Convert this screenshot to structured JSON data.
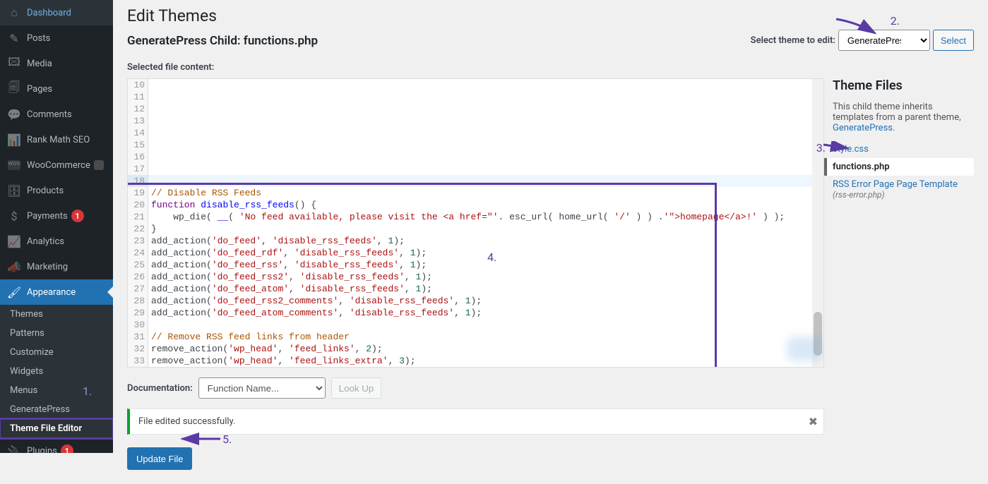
{
  "sidebar": {
    "items": [
      {
        "icon": "dashboard-icon",
        "glyph": "⌂",
        "label": "Dashboard"
      },
      {
        "icon": "posts-icon",
        "glyph": "✎",
        "label": "Posts"
      },
      {
        "icon": "media-icon",
        "glyph": "🖾",
        "label": "Media"
      },
      {
        "icon": "pages-icon",
        "glyph": "🗐",
        "label": "Pages"
      },
      {
        "icon": "comments-icon",
        "glyph": "💬",
        "label": "Comments"
      },
      {
        "icon": "rankmath-icon",
        "glyph": "📊",
        "label": "Rank Math SEO"
      },
      {
        "icon": "woocommerce-icon",
        "glyph": "woo",
        "label": "WooCommerce",
        "badge": ""
      },
      {
        "icon": "products-icon",
        "glyph": "🗄",
        "label": "Products"
      },
      {
        "icon": "payments-icon",
        "glyph": "$",
        "label": "Payments",
        "badge": "1"
      },
      {
        "icon": "analytics-icon",
        "glyph": "📈",
        "label": "Analytics"
      },
      {
        "icon": "marketing-icon",
        "glyph": "📣",
        "label": "Marketing"
      },
      {
        "icon": "appearance-icon",
        "glyph": "🖌",
        "label": "Appearance",
        "current": true
      },
      {
        "icon": "plugins-icon",
        "glyph": "🔌",
        "label": "Plugins",
        "badge": "1"
      }
    ],
    "submenu": [
      {
        "label": "Themes"
      },
      {
        "label": "Patterns"
      },
      {
        "label": "Customize"
      },
      {
        "label": "Widgets"
      },
      {
        "label": "Menus"
      },
      {
        "label": "GeneratePress",
        "anno": "1."
      },
      {
        "label": "Theme File Editor",
        "active": true
      }
    ]
  },
  "page": {
    "title": "Edit Themes",
    "subtitle": "GeneratePress Child: functions.php",
    "selected_file_label": "Selected file content:",
    "select_theme_label": "Select theme to edit:",
    "theme_option": "GeneratePress Child",
    "select_btn": "Select"
  },
  "code": {
    "lines": [
      {
        "n": 10,
        "html": ""
      },
      {
        "n": 11,
        "html": ""
      },
      {
        "n": 12,
        "html": ""
      },
      {
        "n": 13,
        "html": ""
      },
      {
        "n": 14,
        "html": ""
      },
      {
        "n": 15,
        "html": ""
      },
      {
        "n": 16,
        "html": ""
      },
      {
        "n": 17,
        "html": ""
      },
      {
        "n": 18,
        "html": "",
        "hl": true
      },
      {
        "n": 19,
        "html": "<span class='c-comment'>// Disable RSS Feeds</span>"
      },
      {
        "n": 20,
        "html": "<span class='c-keyword'>function</span> <span class='c-def'>disable_rss_feeds</span>() {"
      },
      {
        "n": 21,
        "html": "    wp_die( <span class='c-def'>__</span>( <span class='c-string'>'No feed available, please visit the &lt;a href=\"'</span>. esc_url( home_url( <span class='c-string'>'/'</span> ) ) .<span class='c-string'>'\"&gt;homepage&lt;/a&gt;!'</span> ) );"
      },
      {
        "n": 22,
        "html": "}"
      },
      {
        "n": 23,
        "html": "add_action(<span class='c-string'>'do_feed'</span>, <span class='c-string'>'disable_rss_feeds'</span>, <span class='c-num'>1</span>);"
      },
      {
        "n": 24,
        "html": "add_action(<span class='c-string'>'do_feed_rdf'</span>, <span class='c-string'>'disable_rss_feeds'</span>, <span class='c-num'>1</span>);"
      },
      {
        "n": 25,
        "html": "add_action(<span class='c-string'>'do_feed_rss'</span>, <span class='c-string'>'disable_rss_feeds'</span>, <span class='c-num'>1</span>);"
      },
      {
        "n": 26,
        "html": "add_action(<span class='c-string'>'do_feed_rss2'</span>, <span class='c-string'>'disable_rss_feeds'</span>, <span class='c-num'>1</span>);"
      },
      {
        "n": 27,
        "html": "add_action(<span class='c-string'>'do_feed_atom'</span>, <span class='c-string'>'disable_rss_feeds'</span>, <span class='c-num'>1</span>);"
      },
      {
        "n": 28,
        "html": "add_action(<span class='c-string'>'do_feed_rss2_comments'</span>, <span class='c-string'>'disable_rss_feeds'</span>, <span class='c-num'>1</span>);"
      },
      {
        "n": 29,
        "html": "add_action(<span class='c-string'>'do_feed_atom_comments'</span>, <span class='c-string'>'disable_rss_feeds'</span>, <span class='c-num'>1</span>);"
      },
      {
        "n": 30,
        "html": ""
      },
      {
        "n": 31,
        "html": "<span class='c-comment'>// Remove RSS feed links from header</span>"
      },
      {
        "n": 32,
        "html": "remove_action(<span class='c-string'>'wp_head'</span>, <span class='c-string'>'feed_links'</span>, <span class='c-num'>2</span>);"
      },
      {
        "n": 33,
        "html": "remove_action(<span class='c-string'>'wp_head'</span>, <span class='c-string'>'feed_links_extra'</span>, <span class='c-num'>3</span>);"
      }
    ]
  },
  "files": {
    "heading": "Theme Files",
    "note_pre": "This child theme inherits templates from a parent theme, ",
    "note_link": "GeneratePress",
    "list": [
      {
        "label": "style.css"
      },
      {
        "label": "functions.php",
        "active": true
      },
      {
        "label": "RSS Error Page Page Template",
        "sub": "(rss-error.php)"
      }
    ]
  },
  "docs": {
    "label": "Documentation:",
    "option": "Function Name...",
    "lookup": "Look Up"
  },
  "notice": {
    "text": "File edited successfully."
  },
  "update_btn": "Update File",
  "anno": {
    "a1": "1.",
    "a2": "2.",
    "a3": "3.",
    "a4": "4.",
    "a5": "5."
  }
}
